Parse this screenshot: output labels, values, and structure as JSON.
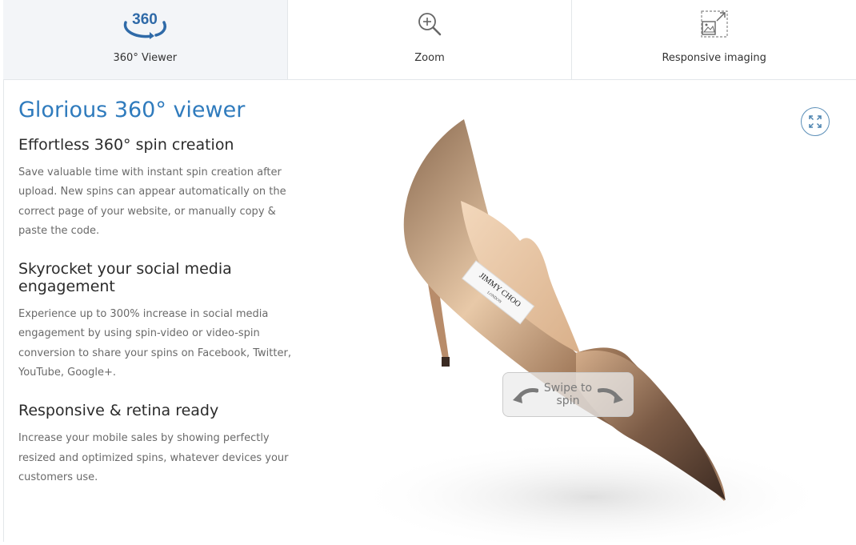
{
  "tabs": [
    {
      "label": "360° Viewer",
      "icon": "360-spin-icon",
      "active": true
    },
    {
      "label": "Zoom",
      "icon": "zoom-in-icon",
      "active": false
    },
    {
      "label": "Responsive imaging",
      "icon": "responsive-image-icon",
      "active": false
    }
  ],
  "icon_360_text": "360",
  "main": {
    "title": "Glorious 360° viewer",
    "sections": [
      {
        "heading": "Effortless 360° spin creation",
        "body": "Save valuable time with instant spin creation after upload. New spins can appear automatically on the correct page of your website, or manually copy & paste the code."
      },
      {
        "heading": "Skyrocket your social media engagement",
        "body": "Experience up to 300% increase in social media engagement by using spin-video or video-spin conversion to share your spins on Facebook, Twitter, YouTube, Google+."
      },
      {
        "heading": "Responsive & retina ready",
        "body": "Increase your mobile sales by showing perfectly resized and optimized spins, whatever devices your customers use."
      }
    ]
  },
  "viewer": {
    "swipe_hint": "Swipe to spin",
    "shoe_label_brand": "JIMMY CHOO",
    "shoe_label_city": "LONDON"
  },
  "colors": {
    "accent": "#2f7bbd",
    "tab_active_bg": "#f3f5f8",
    "shoe_metal": "#c9a07e"
  }
}
